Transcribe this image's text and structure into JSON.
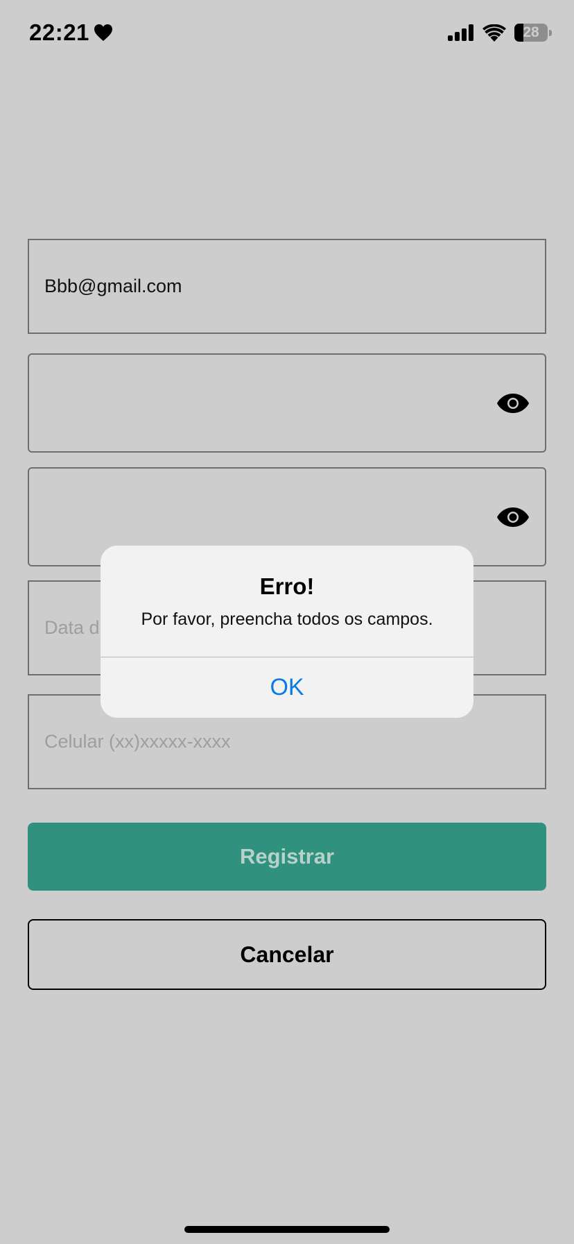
{
  "status_bar": {
    "time": "22:21",
    "battery_level": "28",
    "icons": [
      "heart-icon",
      "signal-icon",
      "wifi-icon",
      "battery-icon"
    ]
  },
  "form": {
    "email_value": "Bbb@gmail.com",
    "password_value": "",
    "confirm_password_value": "",
    "birthdate_placeholder": "Data d",
    "phone_placeholder": "Celular (xx)xxxxx-xxxx"
  },
  "buttons": {
    "register_label": "Registrar",
    "cancel_label": "Cancelar"
  },
  "alert": {
    "title": "Erro!",
    "message": "Por favor, preencha todos os campos.",
    "ok_label": "OK"
  },
  "colors": {
    "background": "#cdcdcd",
    "primary_button": "#30917e",
    "link_blue": "#0a7ae6",
    "alert_background": "#f2f2f2"
  }
}
